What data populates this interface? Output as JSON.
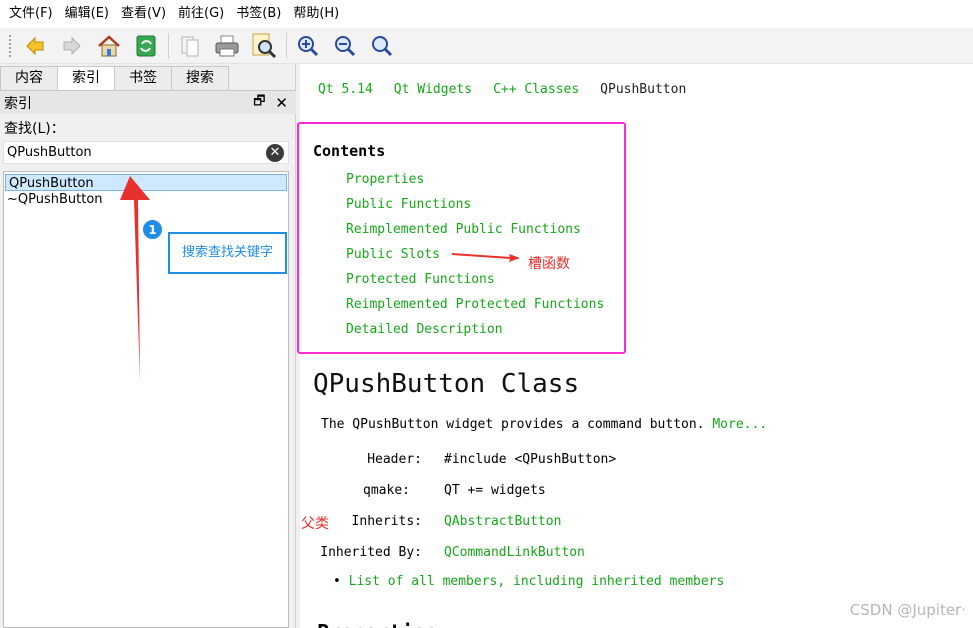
{
  "menubar": {
    "items": [
      "文件(F)",
      "编辑(E)",
      "查看(V)",
      "前往(G)",
      "书签(B)",
      "帮助(H)"
    ]
  },
  "toolbar": {
    "buttons": [
      "back-icon",
      "forward-icon",
      "home-icon",
      "sync-icon",
      "copy-icon",
      "print-icon",
      "find-icon",
      "zoom-in-icon",
      "zoom-out-icon",
      "zoom-reset-icon"
    ]
  },
  "sidebar": {
    "tabs": [
      "内容",
      "索引",
      "书签",
      "搜索"
    ],
    "active_tab": "索引",
    "dock_title": "索引",
    "find_label": "查找(L)：",
    "search_value": "QPushButton",
    "results": [
      "QPushButton",
      "~QPushButton"
    ]
  },
  "content": {
    "breadcrumbs": [
      "Qt 5.14",
      "Qt Widgets",
      "C++ Classes",
      "QPushButton"
    ],
    "contents_title": "Contents",
    "contents_links": [
      "Properties",
      "Public Functions",
      "Reimplemented Public Functions",
      "Public Slots",
      "Protected Functions",
      "Reimplemented Protected Functions",
      "Detailed Description"
    ],
    "class_title": "QPushButton Class",
    "brief": "The QPushButton widget provides a command button.",
    "more_label": "More...",
    "header_label": "Header:",
    "header_value": "#include <QPushButton>",
    "qmake_label": "qmake:",
    "qmake_value": "QT += widgets",
    "inherits_label": "Inherits:",
    "inherits_value": "QAbstractButton",
    "inherited_by_label": "Inherited By:",
    "inherited_by_value": "QCommandLinkButton",
    "members_link": "List of all members, including inherited members",
    "next_heading": "Properties"
  },
  "annotations": {
    "slot_note": "槽函数",
    "parent_note": "父类",
    "callout_text": "搜索查找关键字",
    "callout_number": "1",
    "watermark": "CSDN @Jupiter·",
    "colors": {
      "arrow_red": "#e8302d",
      "box_magenta": "#ff2bd0",
      "callout_blue": "#1e8ee8",
      "link_green": "#17a81a"
    }
  }
}
